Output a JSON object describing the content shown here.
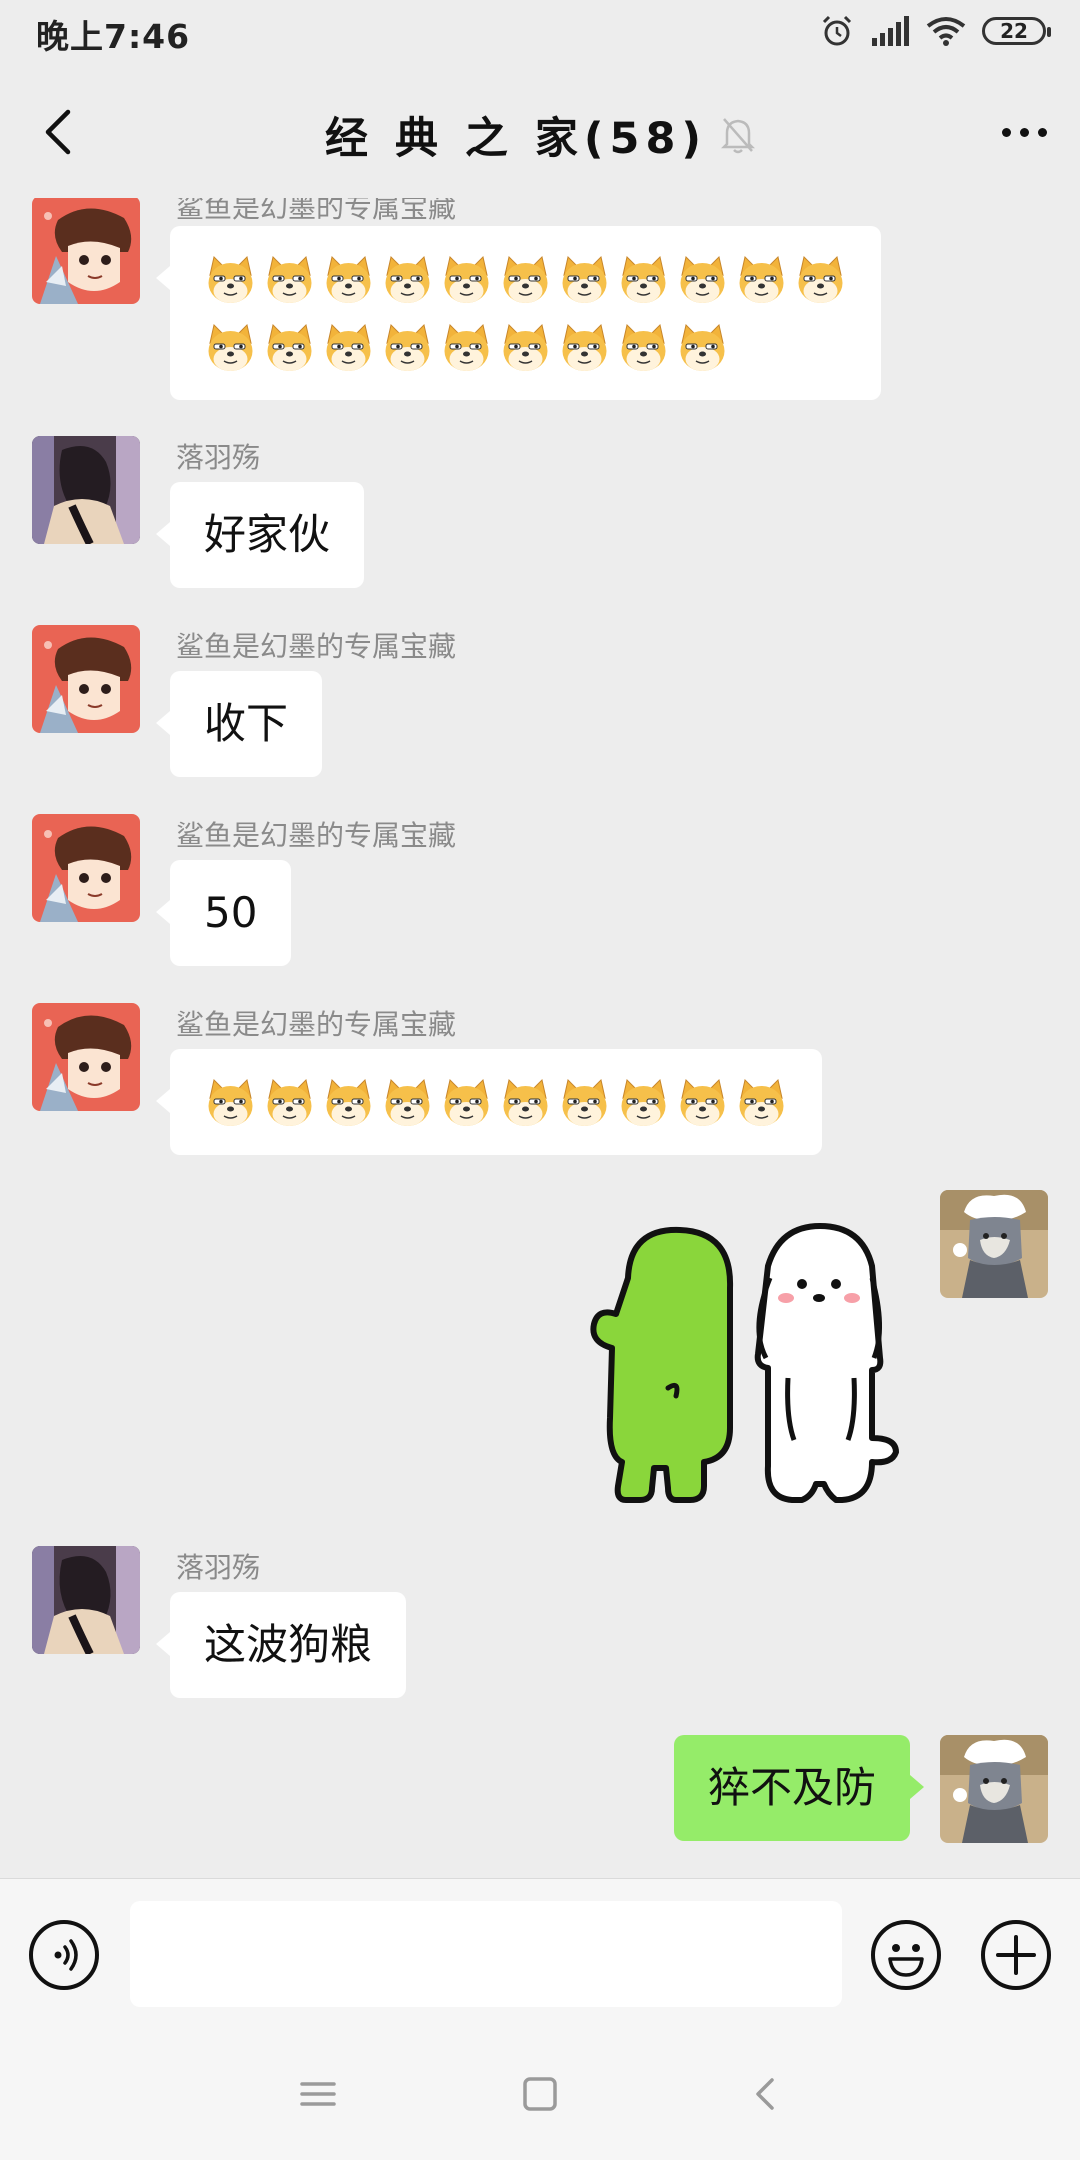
{
  "status_bar": {
    "time": "晚上7:46",
    "battery": "22"
  },
  "nav": {
    "title": "经 典 之 家(58)"
  },
  "messages": [
    {
      "side": "left",
      "sender": "鲨鱼是幻墨的专属宝藏",
      "type": "emoji",
      "emoji_rows": [
        11,
        9
      ],
      "emoji_icon": "doge-emoji"
    },
    {
      "side": "left",
      "sender": "落羽殇",
      "type": "text",
      "text": "好家伙"
    },
    {
      "side": "left",
      "sender": "鲨鱼是幻墨的专属宝藏",
      "type": "text",
      "text": "收下"
    },
    {
      "side": "left",
      "sender": "鲨鱼是幻墨的专属宝藏",
      "type": "text",
      "text": "50"
    },
    {
      "side": "left",
      "sender": "鲨鱼是幻墨的专属宝藏",
      "type": "emoji",
      "emoji_rows": [
        10
      ],
      "emoji_icon": "doge-emoji"
    },
    {
      "side": "right",
      "type": "sticker",
      "sticker": "green-and-white-dog-sticker"
    },
    {
      "side": "left",
      "sender": "落羽殇",
      "type": "text",
      "text": "这波狗粮"
    },
    {
      "side": "right",
      "type": "text",
      "text": "猝不及防"
    }
  ],
  "input": {
    "value": "",
    "placeholder": ""
  },
  "colors": {
    "background": "#ededed",
    "bubble_self": "#95ec69",
    "bubble_other": "#ffffff"
  }
}
